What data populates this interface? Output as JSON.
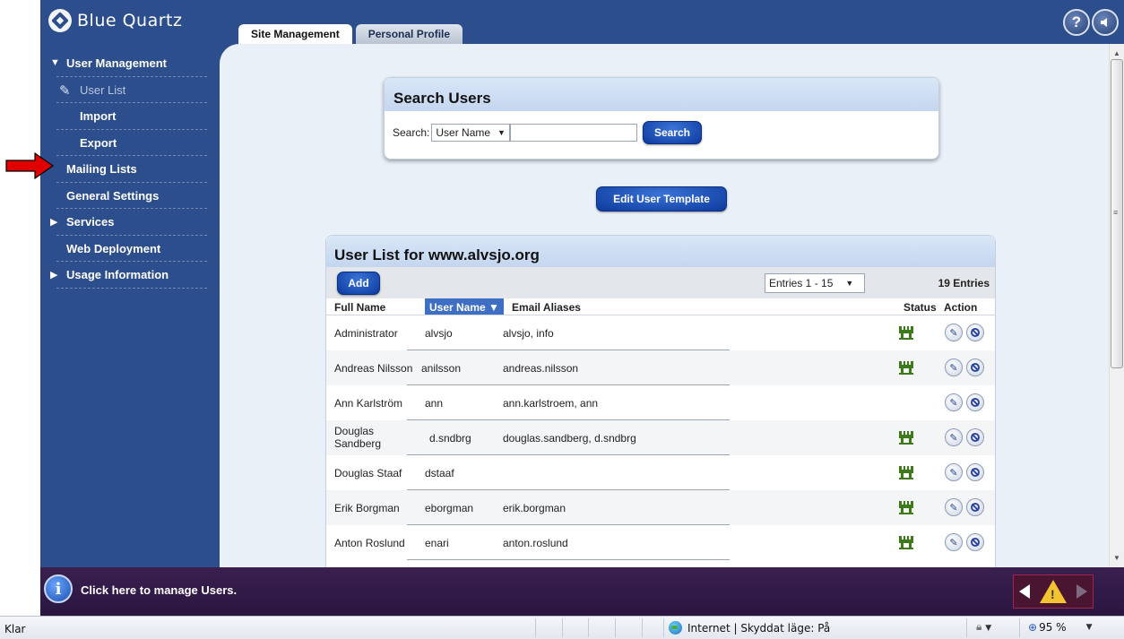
{
  "app": {
    "logo_text": "Blue Quartz"
  },
  "tabs": [
    {
      "label": "Site Management",
      "active": true
    },
    {
      "label": "Personal Profile",
      "active": false
    }
  ],
  "header_buttons": {
    "help_icon": "help-icon",
    "help_glyph": "?",
    "audio_icon": "speaker-icon"
  },
  "sidebar": {
    "items": [
      {
        "label": "User Management",
        "icon": "triangle-down-icon",
        "expanded": true
      },
      {
        "label": "User List",
        "icon": "pencil-icon",
        "current": true
      },
      {
        "label": "Import"
      },
      {
        "label": "Export"
      },
      {
        "label": "Mailing Lists"
      },
      {
        "label": "General Settings"
      },
      {
        "label": "Services",
        "icon": "triangle-right-icon"
      },
      {
        "label": "Web Deployment"
      },
      {
        "label": "Usage Information",
        "icon": "triangle-right-icon"
      }
    ]
  },
  "search": {
    "title": "Search Users",
    "label": "Search:",
    "field_value": "User Name",
    "input_value": "",
    "button": "Search"
  },
  "edit_template_button": "Edit User Template",
  "user_list": {
    "title": "User List for www.alvsjo.org",
    "add_button": "Add",
    "entries_select": "Entries 1 - 15",
    "entries_count": "19 Entries",
    "columns": {
      "full_name": "Full Name",
      "user_name": "User Name",
      "sort_indicator": "▼",
      "email_aliases": "Email Aliases",
      "status": "Status",
      "action": "Action"
    },
    "rows": [
      {
        "full_name": "Administrator",
        "user_name": "alvsjo",
        "email": "alvsjo, info",
        "status": true
      },
      {
        "full_name": "Andreas Nilsson",
        "user_name": "anilsson",
        "email": "andreas.nilsson",
        "status": true
      },
      {
        "full_name": "Ann Karlström",
        "user_name": "ann",
        "email": "ann.karlstroem, ann",
        "status": false
      },
      {
        "full_name_line1": "Douglas",
        "full_name_line2": "Sandberg",
        "user_name": "d.sndbrg",
        "email": "douglas.sandberg, d.sndbrg",
        "status": true
      },
      {
        "full_name": "Douglas Staaf",
        "user_name": "dstaaf",
        "email": "",
        "status": true
      },
      {
        "full_name": "Erik Borgman",
        "user_name": "eborgman",
        "email": "erik.borgman",
        "status": true
      },
      {
        "full_name": "Anton Roslund",
        "user_name": "enari",
        "email": "anton.roslund",
        "status": true
      }
    ]
  },
  "infobar": {
    "message": "Click here to manage Users.",
    "info_glyph": "i"
  },
  "statusbar": {
    "left": "Klar",
    "zone": "Internet | Skyddat läge: På",
    "zoom": "95 %"
  },
  "colors": {
    "frame_blue": "#2c4e8c",
    "content_bg": "#eaf0f8",
    "button_blue": "#1a4fb8",
    "infobar_purple": "#2f1a45",
    "status_green": "#3d7a1a",
    "annotation_red": "#e00000"
  }
}
